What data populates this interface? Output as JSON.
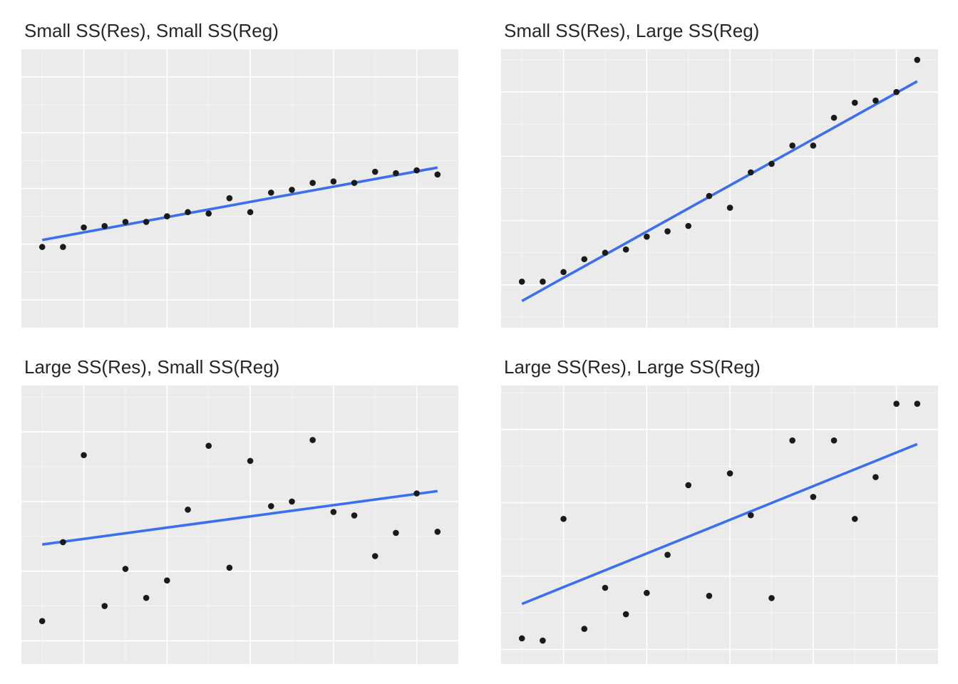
{
  "chart_data": [
    {
      "id": "tl",
      "title": "Small SS(Res), Small SS(Reg)",
      "type": "scatter",
      "xlim": [
        0,
        21
      ],
      "ylim": [
        -6,
        14
      ],
      "line": {
        "x1": 1,
        "y1": 0.3,
        "x2": 20,
        "y2": 5.5
      },
      "points": [
        {
          "x": 1,
          "y": -0.2
        },
        {
          "x": 2,
          "y": -0.2
        },
        {
          "x": 3,
          "y": 1.2
        },
        {
          "x": 4,
          "y": 1.3
        },
        {
          "x": 5,
          "y": 1.6
        },
        {
          "x": 6,
          "y": 1.6
        },
        {
          "x": 7,
          "y": 2.0
        },
        {
          "x": 8,
          "y": 2.3
        },
        {
          "x": 9,
          "y": 2.2
        },
        {
          "x": 10,
          "y": 3.3
        },
        {
          "x": 11,
          "y": 2.3
        },
        {
          "x": 12,
          "y": 3.7
        },
        {
          "x": 13,
          "y": 3.9
        },
        {
          "x": 14,
          "y": 4.4
        },
        {
          "x": 15,
          "y": 4.5
        },
        {
          "x": 16,
          "y": 4.4
        },
        {
          "x": 17,
          "y": 5.2
        },
        {
          "x": 18,
          "y": 5.1
        },
        {
          "x": 19,
          "y": 5.3
        },
        {
          "x": 20,
          "y": 5.0
        }
      ],
      "grid_x_major": [
        3,
        7,
        11,
        15,
        19
      ],
      "grid_x_minor": [
        1,
        5,
        9,
        13,
        17
      ],
      "grid_y_major": [
        -4,
        0,
        4,
        8,
        12
      ],
      "grid_y_minor": [
        -6,
        -2,
        2,
        6,
        10,
        14
      ]
    },
    {
      "id": "tr",
      "title": "Small SS(Res), Large SS(Reg)",
      "type": "scatter",
      "xlim": [
        0,
        21
      ],
      "ylim": [
        -4,
        22
      ],
      "line": {
        "x1": 1,
        "y1": -1.5,
        "x2": 20,
        "y2": 19.0
      },
      "points": [
        {
          "x": 1,
          "y": 0.3
        },
        {
          "x": 2,
          "y": 0.3
        },
        {
          "x": 3,
          "y": 1.2
        },
        {
          "x": 4,
          "y": 2.4
        },
        {
          "x": 5,
          "y": 3.0
        },
        {
          "x": 6,
          "y": 3.3
        },
        {
          "x": 7,
          "y": 4.5
        },
        {
          "x": 8,
          "y": 5.0
        },
        {
          "x": 9,
          "y": 5.5
        },
        {
          "x": 10,
          "y": 8.3
        },
        {
          "x": 11,
          "y": 7.2
        },
        {
          "x": 12,
          "y": 10.5
        },
        {
          "x": 13,
          "y": 11.3
        },
        {
          "x": 14,
          "y": 13.0
        },
        {
          "x": 15,
          "y": 13.0
        },
        {
          "x": 16,
          "y": 15.6
        },
        {
          "x": 17,
          "y": 17.0
        },
        {
          "x": 18,
          "y": 17.2
        },
        {
          "x": 19,
          "y": 18.0
        },
        {
          "x": 20,
          "y": 21.0
        }
      ],
      "grid_x_major": [
        3,
        7,
        11,
        15,
        19
      ],
      "grid_x_minor": [
        1,
        5,
        9,
        13,
        17
      ],
      "grid_y_major": [
        0,
        6,
        12,
        18
      ],
      "grid_y_minor": [
        -3,
        3,
        9,
        15,
        21
      ]
    },
    {
      "id": "bl",
      "title": "Large SS(Res), Small SS(Reg)",
      "type": "scatter",
      "xlim": [
        0,
        21
      ],
      "ylim": [
        -10,
        14
      ],
      "line": {
        "x1": 1,
        "y1": 0.3,
        "x2": 20,
        "y2": 4.9
      },
      "points": [
        {
          "x": 1,
          "y": -6.3
        },
        {
          "x": 2,
          "y": 0.5
        },
        {
          "x": 3,
          "y": 8.0
        },
        {
          "x": 4,
          "y": -5.0
        },
        {
          "x": 5,
          "y": -1.8
        },
        {
          "x": 6,
          "y": -4.3
        },
        {
          "x": 7,
          "y": -2.8
        },
        {
          "x": 8,
          "y": 3.3
        },
        {
          "x": 9,
          "y": 8.8
        },
        {
          "x": 10,
          "y": -1.7
        },
        {
          "x": 11,
          "y": 7.5
        },
        {
          "x": 12,
          "y": 3.6
        },
        {
          "x": 13,
          "y": 4.0
        },
        {
          "x": 14,
          "y": 9.3
        },
        {
          "x": 15,
          "y": 3.1
        },
        {
          "x": 16,
          "y": 2.8
        },
        {
          "x": 17,
          "y": -0.7
        },
        {
          "x": 18,
          "y": 1.3
        },
        {
          "x": 19,
          "y": 4.7
        },
        {
          "x": 20,
          "y": 1.4
        }
      ],
      "grid_x_major": [
        3,
        7,
        11,
        15,
        19
      ],
      "grid_x_minor": [
        1,
        5,
        9,
        13,
        17
      ],
      "grid_y_major": [
        -8,
        -2,
        4,
        10
      ],
      "grid_y_minor": [
        -5,
        1,
        7,
        13
      ]
    },
    {
      "id": "br",
      "title": "Large SS(Res), Large SS(Reg)",
      "type": "scatter",
      "xlim": [
        0,
        21
      ],
      "ylim": [
        -12,
        26
      ],
      "line": {
        "x1": 1,
        "y1": -3.8,
        "x2": 20,
        "y2": 18.0
      },
      "points": [
        {
          "x": 1,
          "y": -8.5
        },
        {
          "x": 2,
          "y": -8.8
        },
        {
          "x": 3,
          "y": 7.8
        },
        {
          "x": 4,
          "y": -7.2
        },
        {
          "x": 5,
          "y": -1.6
        },
        {
          "x": 6,
          "y": -5.2
        },
        {
          "x": 7,
          "y": -2.3
        },
        {
          "x": 8,
          "y": 2.9
        },
        {
          "x": 9,
          "y": 12.4
        },
        {
          "x": 10,
          "y": -2.7
        },
        {
          "x": 11,
          "y": 14.0
        },
        {
          "x": 12,
          "y": 8.3
        },
        {
          "x": 13,
          "y": -3.0
        },
        {
          "x": 14,
          "y": 18.5
        },
        {
          "x": 15,
          "y": 10.8
        },
        {
          "x": 16,
          "y": 18.5
        },
        {
          "x": 17,
          "y": 7.8
        },
        {
          "x": 18,
          "y": 13.5
        },
        {
          "x": 19,
          "y": 23.5
        },
        {
          "x": 20,
          "y": 23.5
        }
      ],
      "grid_x_major": [
        3,
        7,
        11,
        15,
        19
      ],
      "grid_x_minor": [
        1,
        5,
        9,
        13,
        17
      ],
      "grid_y_major": [
        -10,
        0,
        10,
        20
      ],
      "grid_y_minor": [
        -5,
        5,
        15,
        25
      ]
    }
  ],
  "colors": {
    "line": "#3b6ff2",
    "panel_bg": "#ebebeb",
    "grid_major": "#ffffff"
  }
}
